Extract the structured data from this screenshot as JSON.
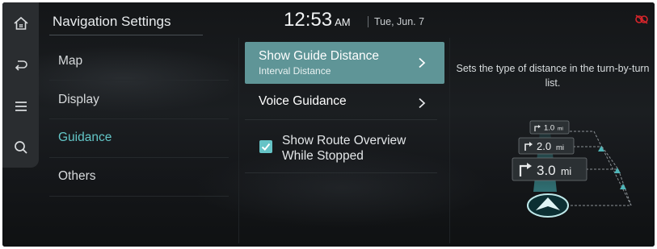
{
  "header": {
    "title": "Navigation Settings",
    "time": "12:53",
    "ampm": "AM",
    "date": "Tue, Jun. 7"
  },
  "rail": [
    {
      "icon": "home-icon"
    },
    {
      "icon": "back-icon"
    },
    {
      "icon": "menu-icon"
    },
    {
      "icon": "search-icon"
    }
  ],
  "menu": {
    "items": [
      "Map",
      "Display",
      "Guidance",
      "Others"
    ],
    "active": "Guidance"
  },
  "options": {
    "guide_distance": {
      "label": "Show Guide Distance",
      "value": "Interval Distance"
    },
    "voice_guidance": {
      "label": "Voice Guidance"
    },
    "route_overview": {
      "label": "Show Route Overview While Stopped",
      "checked": true
    }
  },
  "description": "Sets the type of distance in the turn-by-turn list.",
  "illustration": {
    "distances": [
      {
        "value": "1.0",
        "unit": "mi"
      },
      {
        "value": "2.0",
        "unit": "mi"
      },
      {
        "value": "3.0",
        "unit": "mi"
      }
    ]
  },
  "colors": {
    "accent": "#63c6c7",
    "selected_row": "#5f9597",
    "background": "#121416"
  }
}
